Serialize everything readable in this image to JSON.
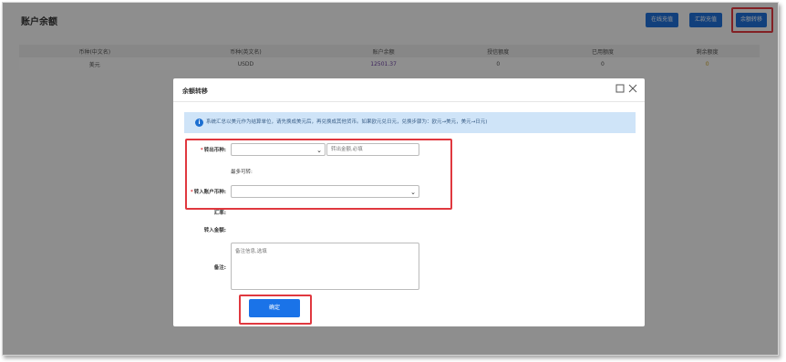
{
  "page": {
    "title": "账户余额",
    "buttons": {
      "online_recharge": "在线充值",
      "wire_recharge": "汇款充值",
      "balance_transfer": "余额转移"
    }
  },
  "table": {
    "headers": [
      "币种(中文名)",
      "币种(英文名)",
      "账户余额",
      "授信额度",
      "已用额度",
      "剩余额度"
    ],
    "rows": [
      [
        "美元",
        "USDD",
        "12501.37",
        "0",
        "0",
        "0"
      ]
    ]
  },
  "modal": {
    "title": "余额转移",
    "notice": "系统汇总以美元作为结算单位，请先换成美元后，再兑换成其他货币。如果欧元兑日元，兑换步骤为：欧元→美元，美元→日元)",
    "fields": {
      "out_currency_label": "转出币种:",
      "amount_placeholder": "转出金额,必填",
      "max_available_label": "最多可转:",
      "in_currency_label": "转入账户币种:",
      "exchange_rate_label": "汇率:",
      "in_amount_label": "转入金额:",
      "remark_label": "备注:",
      "remark_placeholder": "备注信息,选填"
    },
    "confirm_label": "确定"
  },
  "colors": {
    "primary": "#1a73e8",
    "highlight": "#e0383f",
    "notice_bg": "#cfe4f8"
  }
}
